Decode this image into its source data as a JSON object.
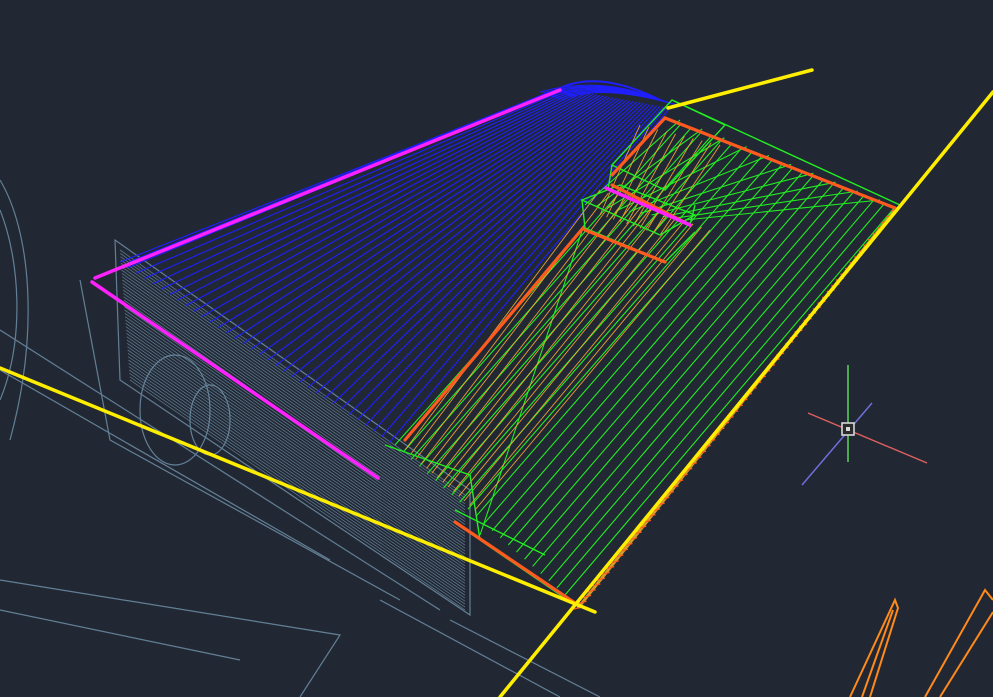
{
  "viewport": {
    "background": "#212833",
    "description_layers": {
      "background_geometry": "#6f8fa8",
      "blue_rays": "#1f1fff",
      "magenta_edge": "#ff22ff",
      "green_rays": "#22ee22",
      "orange_edges": "#ff5a1f",
      "yellow_guides": "#ffee00",
      "gold_hatch": "#d89a2a",
      "ucs_red": "#e06060",
      "ucs_green": "#60e060",
      "ucs_blue": "#7070e0",
      "cursor_box": "#d8d8d8"
    }
  },
  "icons": {
    "crosshair": "crosshair-cursor-icon",
    "ucs": "ucs-axes-icon"
  }
}
